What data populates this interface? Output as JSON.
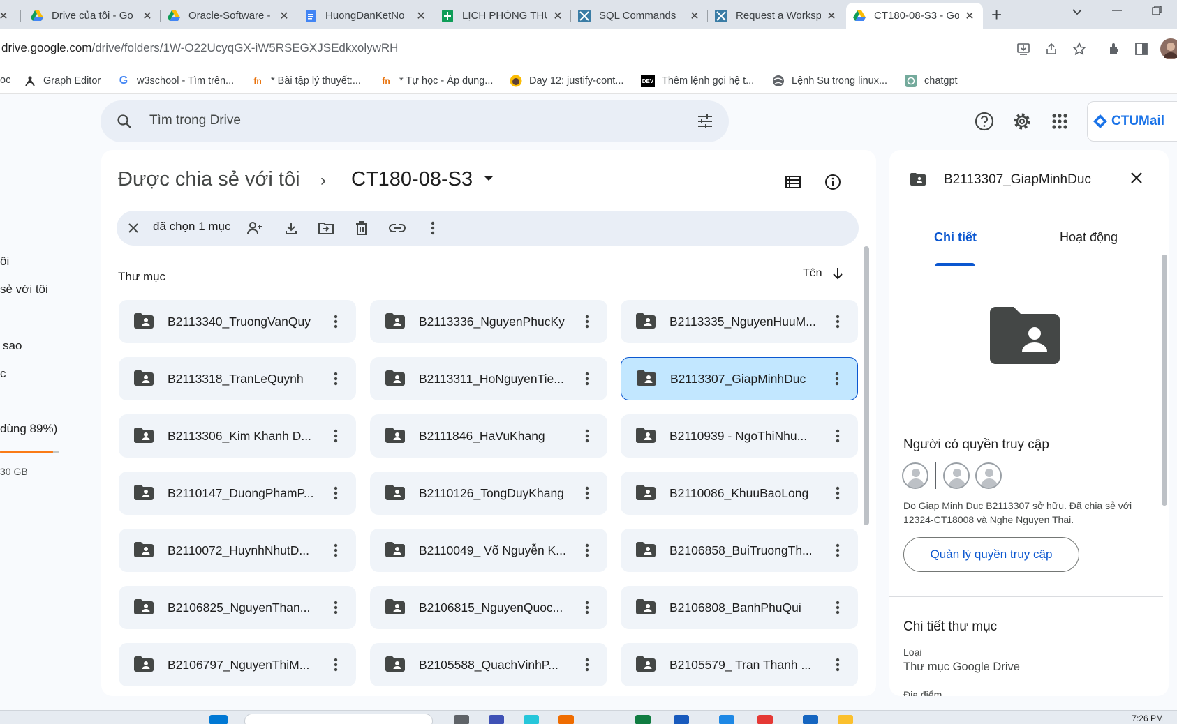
{
  "tabs": [
    {
      "title": "Drive của tôi - Go",
      "icon": "drive-icon"
    },
    {
      "title": "Oracle-Software -",
      "icon": "drive-icon"
    },
    {
      "title": "HuongDanKetNo",
      "icon": "docs-icon"
    },
    {
      "title": "LỊCH PHÒNG THU",
      "icon": "sheets-icon"
    },
    {
      "title": "SQL Commands",
      "icon": "apex-icon"
    },
    {
      "title": "Request a Worksp",
      "icon": "apex-icon"
    },
    {
      "title": "CT180-08-S3 - Go",
      "icon": "drive-icon",
      "active": true
    }
  ],
  "address": {
    "domain": "drive.google.com",
    "path": "/drive/folders/1W-O22UcyqGX-iW5RSEGXJSEdkxolywRH"
  },
  "bookmarks": [
    {
      "label": "oc",
      "icon": ""
    },
    {
      "label": "Graph Editor",
      "icon": "graph-icon"
    },
    {
      "label": "w3school - Tìm trên...",
      "icon": "google-icon"
    },
    {
      "label": "* Bài tập lý thuyết:...",
      "icon": "fn-icon"
    },
    {
      "label": "* Tự học - Áp dụng...",
      "icon": "fn-icon"
    },
    {
      "label": "Day 12: justify-cont...",
      "icon": "face-icon"
    },
    {
      "label": "Thêm lệnh gọi hệ t...",
      "icon": "dev-icon"
    },
    {
      "label": "Lệnh Su trong linux...",
      "icon": "globe-icon"
    },
    {
      "label": "chatgpt",
      "icon": "chatgpt-icon"
    }
  ],
  "search": {
    "placeholder": "Tìm trong Drive"
  },
  "brand": {
    "mail_label": "CTUMail"
  },
  "left_nav": {
    "item1": "ôi",
    "item2": "sẻ với tôi",
    "item3": "sao",
    "item4": "c",
    "storage": "dùng 89%)",
    "storage_fraction": 0.89,
    "quota": "30 GB"
  },
  "breadcrumb": {
    "parent": "Được chia sẻ với tôi",
    "current": "CT180-08-S3"
  },
  "selection": {
    "count_label": "đã chọn 1 mục"
  },
  "section": {
    "title": "Thư mục",
    "sort_label": "Tên"
  },
  "folders": [
    "B2113340_TruongVanQuy",
    "B2113336_NguyenPhucKy",
    "B2113335_NguyenHuuM...",
    "B2113318_TranLeQuynh",
    "B2113311_HoNguyenTie...",
    "B2113307_GiapMinhDuc",
    "B2113306_Kim Khanh D...",
    "B2111846_HaVuKhang",
    "B2110939 - NgoThiNhu...",
    "B2110147_DuongPhamP...",
    "B2110126_TongDuyKhang",
    "B2110086_KhuuBaoLong",
    "B2110072_HuynhNhutD...",
    "B2110049_ Võ Nguyễn K...",
    "B2106858_BuiTruongTh...",
    "B2106825_NguyenThan...",
    "B2106815_NguyenQuoc...",
    "B2106808_BanhPhuQui",
    "B2106797_NguyenThiM...",
    "B2105588_QuachVinhP...",
    "B2105579_ Tran Thanh ..."
  ],
  "selected_folder_index": 5,
  "details": {
    "title": "B2113307_GiapMinhDuc",
    "tab_details": "Chi tiết",
    "tab_activity": "Hoạt động",
    "access_title": "Người có quyền truy cập",
    "owner_text": "Do Giap Minh Duc B2113307 sở hữu. Đã chia sẻ với 12324-CT18008 và Nghe Nguyen Thai.",
    "manage_button": "Quản lý quyền truy cập",
    "section_title": "Chi tiết thư mục",
    "type_label": "Loại",
    "type_value": "Thư mục Google Drive",
    "location_label": "Địa điểm"
  },
  "taskbar": {
    "clock": "7:26 PM"
  },
  "colors": {
    "accent": "#0b57d0",
    "selected_bg": "#c2e7ff",
    "storage": "#fa7b17"
  }
}
